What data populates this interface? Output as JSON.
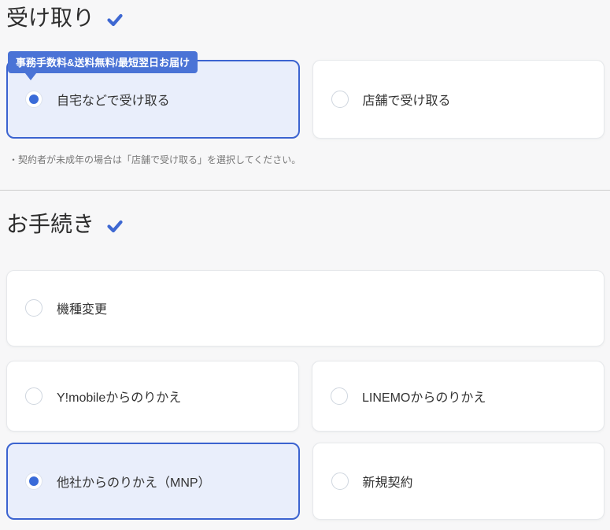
{
  "colors": {
    "accent_blue": "#3e68d2",
    "badge_bg": "#4a73d6",
    "selected_card_bg": "#e9eefb",
    "selected_card_border": "#3b63d0",
    "radio_dot": "#3a6bd8",
    "page_bg": "#f7f7f8"
  },
  "icons": {
    "section_complete": "✓"
  },
  "receiving": {
    "title": "受け取り",
    "badge_label": "事務手数料&送料無料/最短翌日お届け",
    "options": [
      {
        "label": "自宅などで受け取る",
        "selected": true
      },
      {
        "label": "店舗で受け取る",
        "selected": false
      }
    ],
    "note": "・契約者が未成年の場合は「店舗で受け取る」を選択してください。"
  },
  "procedure": {
    "title": "お手続き",
    "options": [
      {
        "label": "機種変更",
        "selected": false
      },
      {
        "label": "Y!mobileからのりかえ",
        "selected": false
      },
      {
        "label": "LINEMOからのりかえ",
        "selected": false
      },
      {
        "label": "他社からのりかえ（MNP）",
        "selected": true
      },
      {
        "label": "新規契約",
        "selected": false
      }
    ]
  }
}
